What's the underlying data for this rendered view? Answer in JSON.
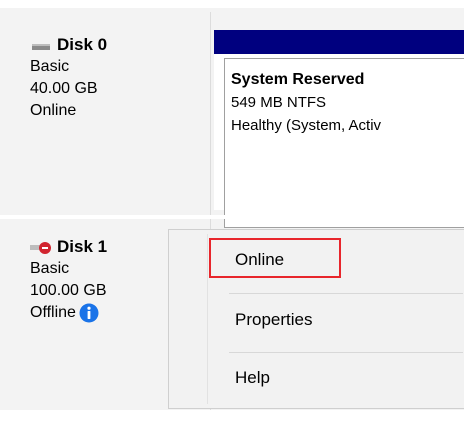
{
  "disks": [
    {
      "title": "Disk 0",
      "type": "Basic",
      "size": "40.00 GB",
      "status": "Online",
      "icon": "disk-online-icon",
      "partition": {
        "name": "System Reserved",
        "size": "549 MB NTFS",
        "status": "Healthy (System, Activ"
      }
    },
    {
      "title": "Disk 1",
      "type": "Basic",
      "size": "100.00 GB",
      "status": "Offline",
      "icon": "disk-offline-icon",
      "status_icon": "info-icon"
    }
  ],
  "context_menu": {
    "items": [
      "Online",
      "Properties",
      "Help"
    ]
  },
  "colors": {
    "partition_bar": "#00007f",
    "highlight": "#e8262c",
    "offline_badge": "#d1242f",
    "info_blue": "#1a73e8"
  }
}
